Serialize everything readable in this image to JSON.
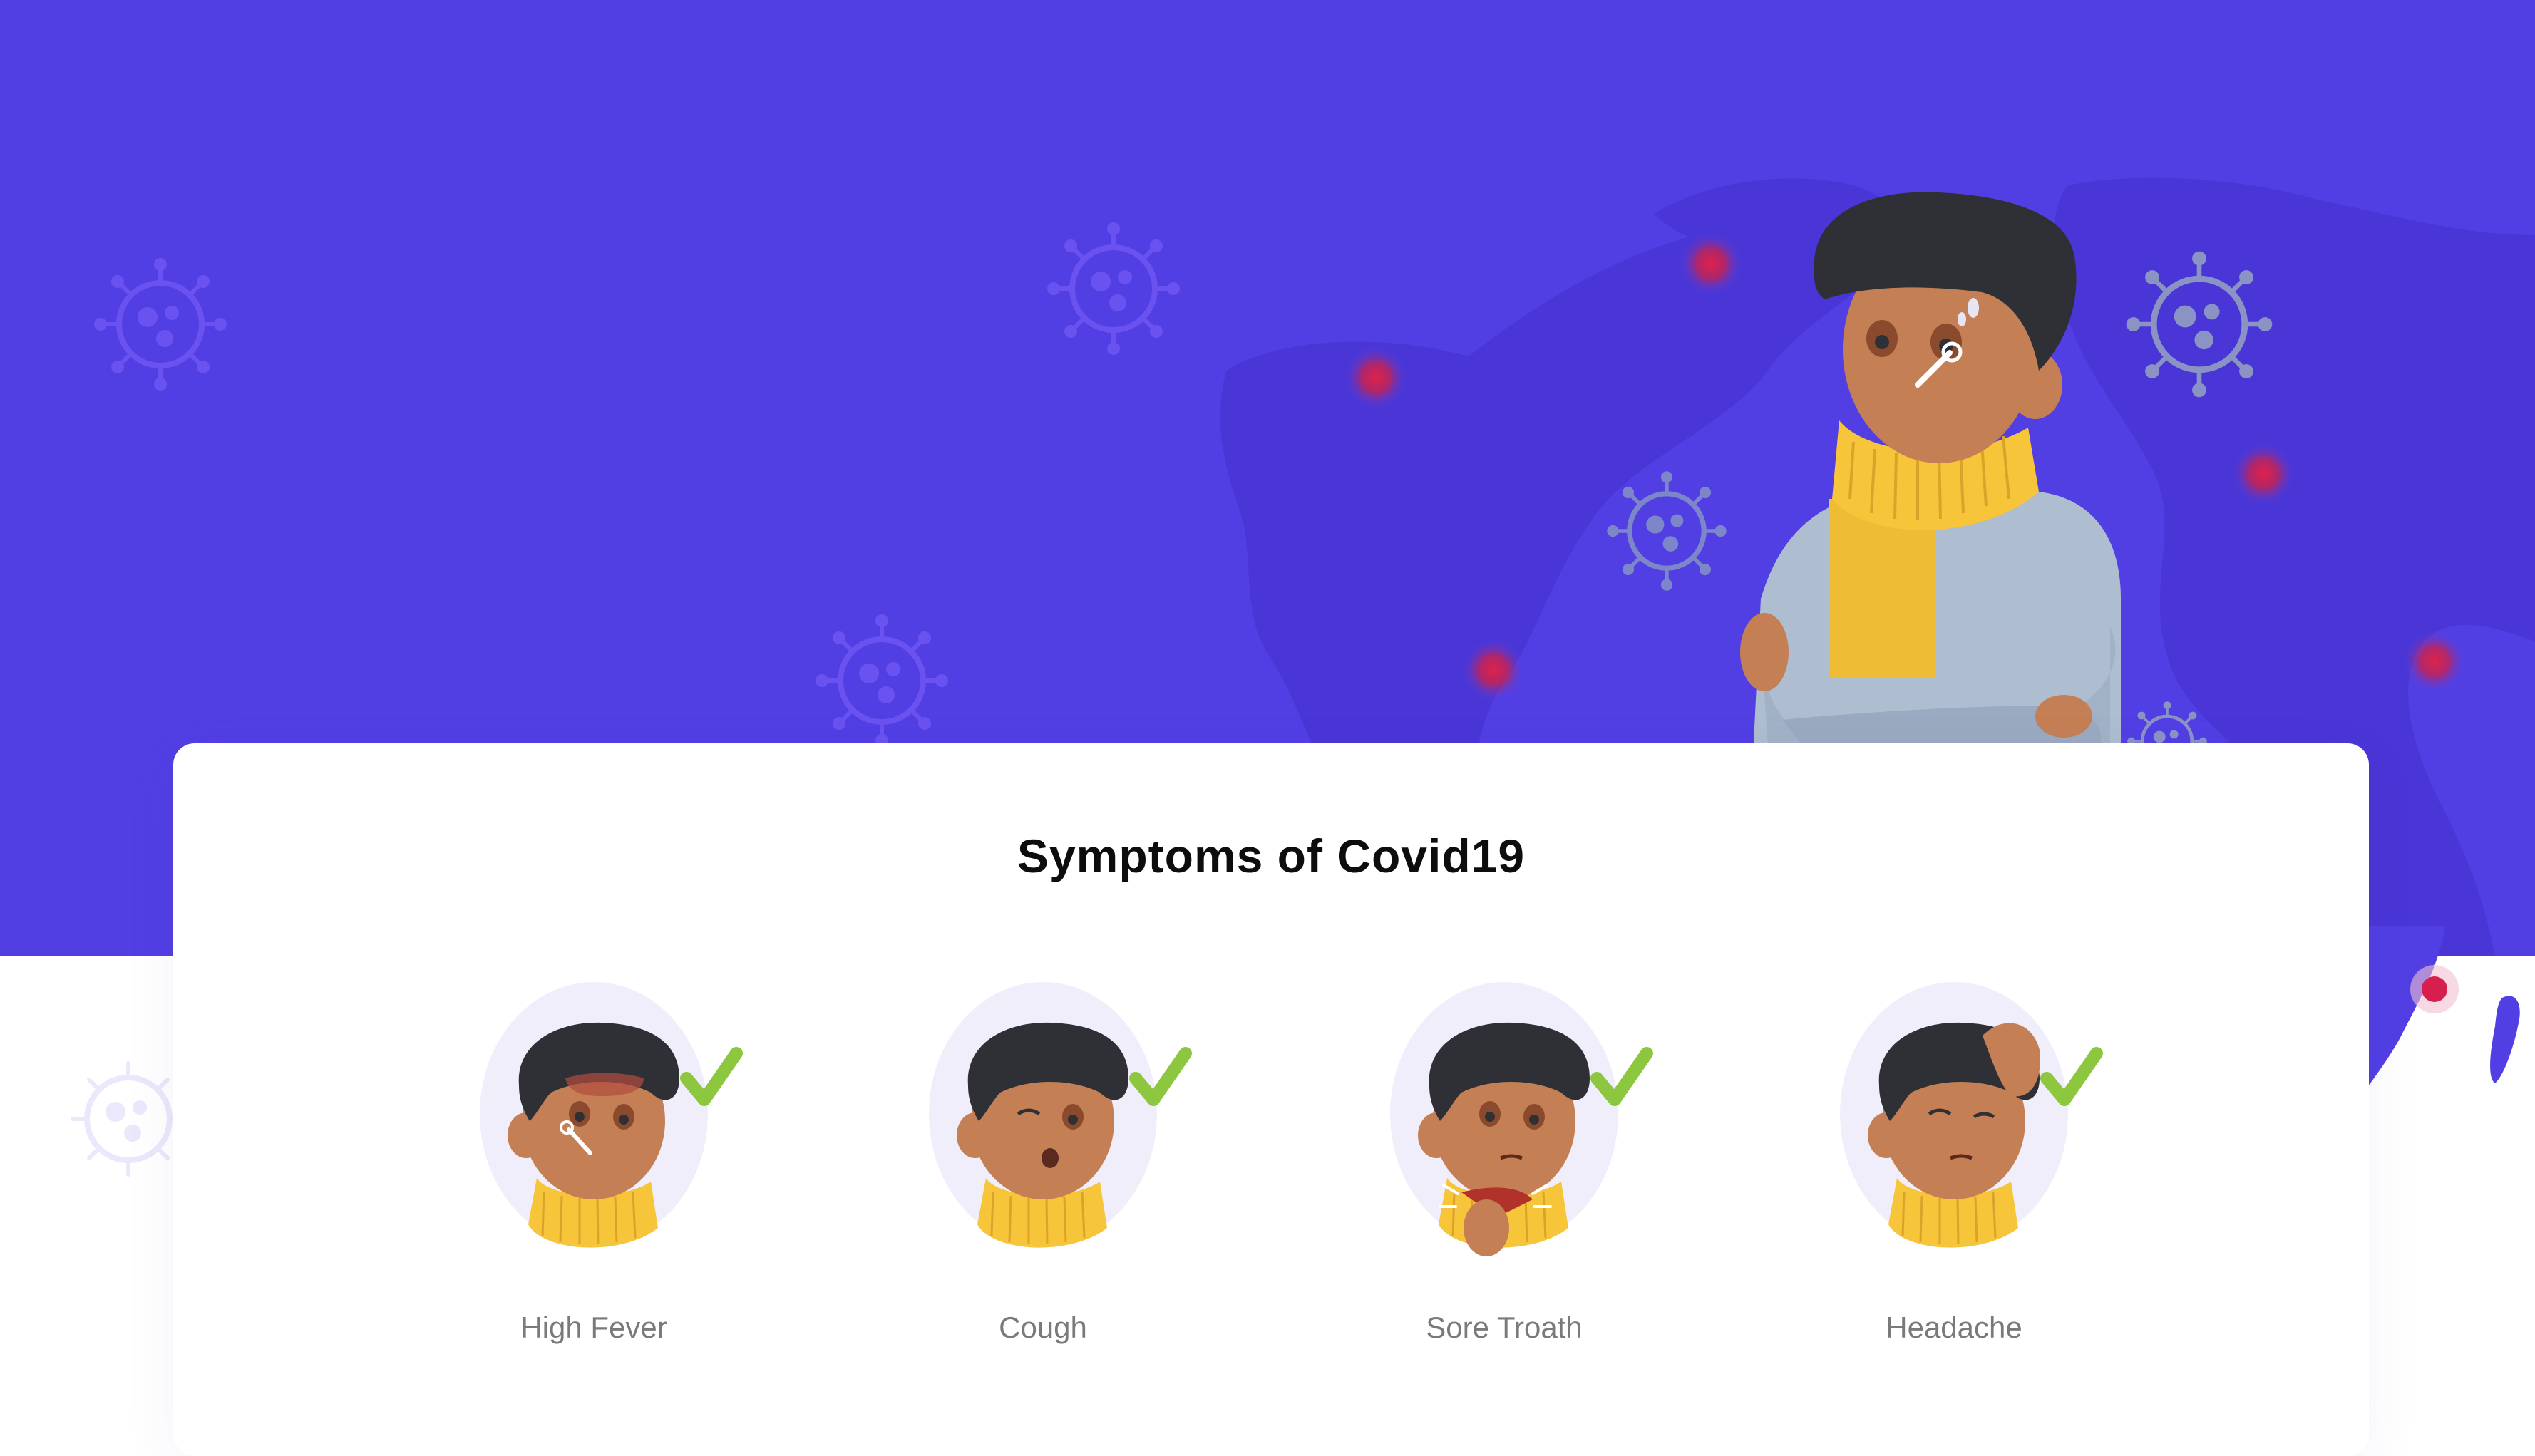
{
  "page": {
    "title": "Symptoms of Covid19"
  },
  "colors": {
    "hero_background": "#523fe4",
    "map_shade": "#4a36d6",
    "hotspot": "#d61f4f",
    "scarf": "#f6c53a",
    "skin": "#c47f55",
    "hair": "#2f3036",
    "check": "#8dc63f",
    "label_text": "#7a7a7a",
    "title_text": "#0d0d0d"
  },
  "symptoms": [
    {
      "label": "High Fever",
      "icon": "fever-icon"
    },
    {
      "label": "Cough",
      "icon": "cough-icon"
    },
    {
      "label": "Sore Troath",
      "icon": "sore-throat-icon"
    },
    {
      "label": "Headache",
      "icon": "headache-icon"
    }
  ]
}
